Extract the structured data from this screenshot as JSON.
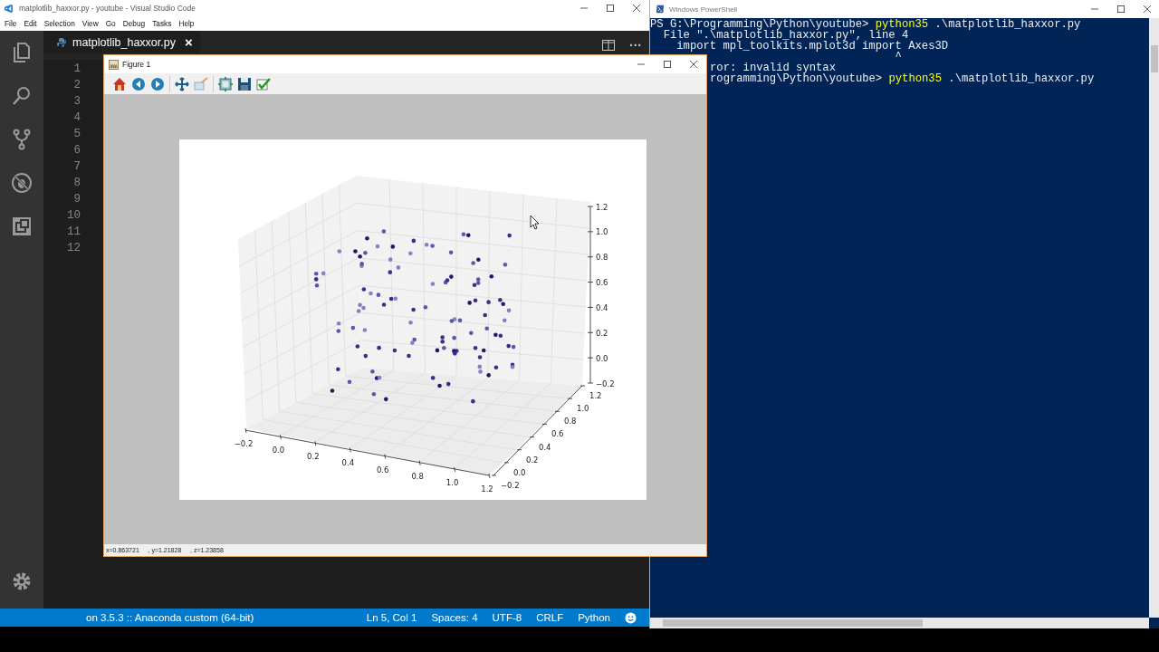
{
  "vscode": {
    "title": "matplotlib_haxxor.py - youtube - Visual Studio Code",
    "menu": [
      "File",
      "Edit",
      "Selection",
      "View",
      "Go",
      "Debug",
      "Tasks",
      "Help"
    ],
    "tab": {
      "label": "matplotlib_haxxor.py",
      "close": "×"
    },
    "more": "···",
    "line_numbers": [
      "1",
      "2",
      "3",
      "4",
      "5",
      "6",
      "7",
      "8",
      "9",
      "10",
      "11",
      "12"
    ],
    "status_bar": {
      "interpreter": "on 3.5.3 :: Anaconda custom (64-bit)",
      "items": [
        "Ln 5, Col 1",
        "Spaces: 4",
        "UTF-8",
        "CRLF",
        "Python"
      ]
    }
  },
  "figure": {
    "title": "Figure 1",
    "plot": {
      "x_ticks": [
        "−0.2",
        "0.0",
        "0.2",
        "0.4",
        "0.6",
        "0.8",
        "1.0",
        "1.2"
      ],
      "y_ticks": [
        "−0.2",
        "0.0",
        "0.2",
        "0.4",
        "0.6",
        "0.8",
        "1.0",
        "1.2"
      ],
      "z_ticks": [
        "1.2",
        "1.0",
        "0.8",
        "0.6",
        "0.4",
        "0.2",
        "0.0",
        "−0.2"
      ]
    },
    "status": "x=0.863721     , y=1.21828     , z=1.23858"
  },
  "powershell": {
    "title": "Windows PowerShell",
    "lines": [
      {
        "kind": "full",
        "parts": [
          {
            "kind": "plain",
            "text": "PS G:\\Programming\\Python\\youtube> "
          },
          {
            "kind": "command",
            "text": "python35"
          },
          {
            "kind": "plain",
            "text": " .\\matplotlib_haxxor.py"
          }
        ]
      },
      {
        "kind": "full",
        "parts": [
          {
            "kind": "plain",
            "text": "  File \".\\matplotlib_haxxor.py\", line 4"
          }
        ]
      },
      {
        "kind": "full",
        "parts": [
          {
            "kind": "plain",
            "text": "    import mpl_toolkits.mplot3d import Axes3D"
          }
        ]
      },
      {
        "kind": "full",
        "parts": [
          {
            "kind": "plain",
            "text": "                                     ^"
          }
        ]
      },
      {
        "kind": "cut",
        "parts": [
          {
            "kind": "plain",
            "text": "ror: invalid syntax"
          }
        ]
      },
      {
        "kind": "cut",
        "parts": [
          {
            "kind": "plain",
            "text": "rogramming\\Python\\youtube> "
          },
          {
            "kind": "command",
            "text": "python35"
          },
          {
            "kind": "plain",
            "text": " .\\matplotlib_haxxor.py"
          }
        ]
      }
    ]
  }
}
